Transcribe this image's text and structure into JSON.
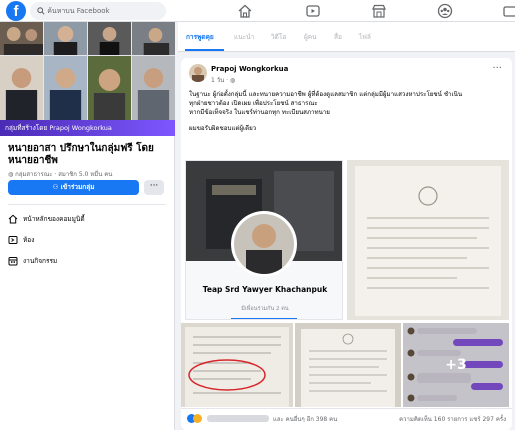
{
  "topbar": {
    "logo": "f",
    "search_placeholder": "ค้นหาบน Facebook",
    "nav_icons": [
      "home-icon",
      "video-icon",
      "marketplace-icon",
      "groups-icon",
      "gaming-icon"
    ]
  },
  "sidebar": {
    "creator_bar": "กลุ่มที่สร้างโดย Prapoj Wongkorkua",
    "group_title": "หนายอาสา ปรึกษาในกลุ่มฟรี โดยหนายอาชีพ",
    "group_meta": "กลุ่มสาธารณะ · สมาชิก 5.0 หมื่น คน",
    "join_label": "เข้าร่วมกลุ่ม",
    "more_label": "···",
    "menu": [
      {
        "icon": "home-icon",
        "label": "หน้าหลักของคอมมูนิตี้"
      },
      {
        "icon": "rooms-icon",
        "label": "ห้อง"
      },
      {
        "icon": "events-icon",
        "label": "งานกิจกรรม"
      }
    ]
  },
  "tabs": [
    {
      "label": "การพูดคุย",
      "active": true
    },
    {
      "label": "แนะนำ",
      "active": false
    },
    {
      "label": "วิดีโอ",
      "active": false
    },
    {
      "label": "ผู้คน",
      "active": false
    },
    {
      "label": "สื่อ",
      "active": false
    },
    {
      "label": "ไฟล์",
      "active": false
    }
  ],
  "post": {
    "author": "Prapoj Wongkorkua",
    "time": "1 วัน · ",
    "more": "···",
    "lines": [
      "ในฐานะ ผู้ก่อตั้งกลุ่มนี้ และทนายความอาชีพ ผู้ที่ต้องดูแลสมาชิก แต่กลุ่มมีผู้มาแสวงหาประโยชน์ ชำเนิน",
      "ทุกฝ่ายชาวต้อง เปิดเผย เพื่อประโยชน์ สาธารณะ",
      "หากมีข้อเท็จจริง ในแชร์ท่านอกทุก ทะเบียนสภาทนาย",
      "ผมขอรับผิดชอบแต่ผู้เดียว"
    ],
    "see_more": "",
    "card_name": "Teap Srd Yawyer Khachanpuk",
    "card_sub": "มีเพื่อนร่วมกัน 2 คน",
    "plus_more": "+3",
    "reaction_text": "และ คนอื่นๆ อีก 398 คน",
    "stats_text": "ความคิดเห็น 160 รายการ  แชร์ 297 ครั้ง"
  },
  "colors": {
    "brand": "#1877f2",
    "purple": "#6a3de8"
  }
}
